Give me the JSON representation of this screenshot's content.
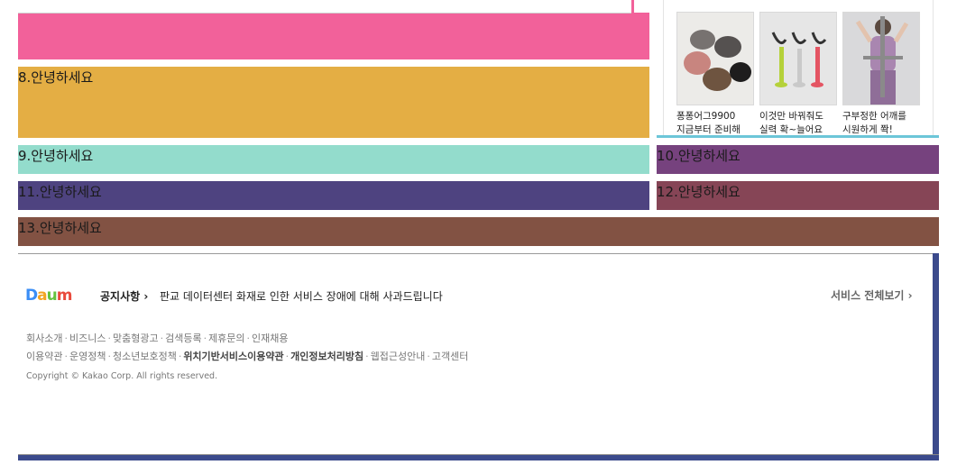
{
  "blocks": {
    "b8": "8.안녕하세요",
    "b9": "9.안녕하세요",
    "b10": "10.안녕하세요",
    "b11": "11.안녕하세요",
    "b12": "12.안녕하세요",
    "b13": "13.안녕하세요"
  },
  "colors": {
    "pink": "#f2619a",
    "b8": "#e4ae44",
    "b9": "#93dccc",
    "b10": "#76427e",
    "b11": "#4e4380",
    "b12": "#864556",
    "b13": "#825243",
    "panel_line": "#6cc6d8",
    "footer_frame": "#3b4a8c"
  },
  "products": [
    {
      "line1": "퐁퐁어그9900",
      "line2": "지금부터 준비해",
      "image": "fluffy-slippers"
    },
    {
      "line1": "이것만 바꿔줘도",
      "line2": "실력 확~늘어요",
      "image": "golf-tees"
    },
    {
      "line1": "구부정한 어깨를",
      "line2": "시원하게 쫙!",
      "image": "posture-bar-woman"
    }
  ],
  "footer": {
    "logo": [
      "D",
      "a",
      "u",
      "m"
    ],
    "notice_label": "공지사항",
    "notice_text": "판교 데이터센터 화재로 인한 서비스 장애에 대해 사과드립니다",
    "all_services": "서비스 전체보기",
    "links_row1": [
      "회사소개",
      "비즈니스",
      "맞춤형광고",
      "검색등록",
      "제휴문의",
      "인재채용"
    ],
    "links_row2": [
      "이용약관",
      "운영정책",
      "청소년보호정책",
      "위치기반서비스이용약관",
      "개인정보처리방침",
      "웹접근성안내",
      "고객센터"
    ],
    "copyright": "Copyright © Kakao Corp. All rights reserved."
  }
}
